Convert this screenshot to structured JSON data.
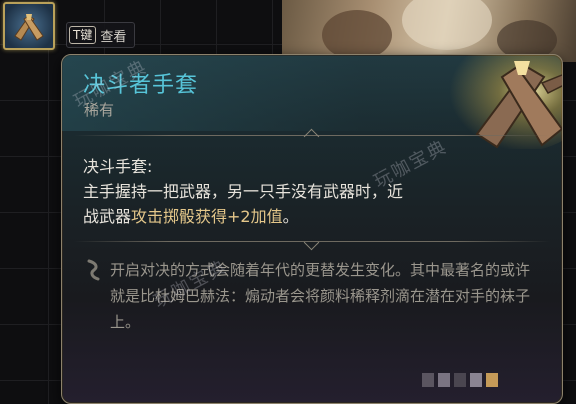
{
  "hint": {
    "key": "T键",
    "label": "查看"
  },
  "item": {
    "name": "决斗者手套",
    "rarity": "稀有",
    "passive_name": "决斗手套:",
    "passive_desc_1": "主手握持一把武器，另一只手没有武器时，近战武器",
    "passive_desc_highlight": "攻击掷骰获得+2加值",
    "passive_desc_2": "。",
    "lore": "开启对决的方式会随着年代的更替发生变化。其中最著名的或许就是比杜姆巴赫法：煽动者会将颜料稀释剂滴在潜在对手的袜子上。"
  },
  "watermarks": [
    "玩咖宝典",
    "玩咖宝典",
    "玩咖宝典"
  ],
  "colors": {
    "title": "#57c5d9",
    "highlight": "#e4c78a",
    "body_text": "#e8e4dc",
    "lore_text": "#9a968d",
    "frame": "#8d826c"
  },
  "icons": [
    "gloves-icon",
    "lore-quill-icon"
  ]
}
